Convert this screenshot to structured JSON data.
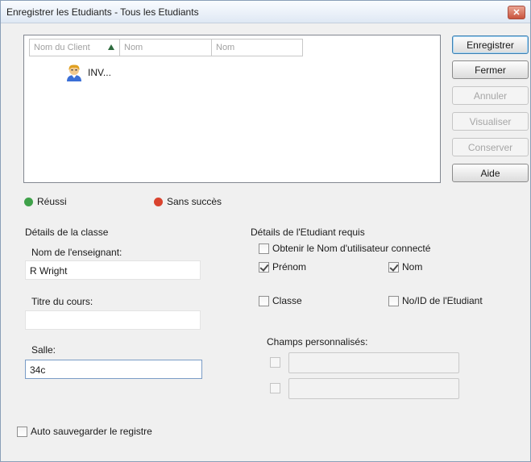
{
  "window": {
    "title": "Enregistrer les Etudiants - Tous les Etudiants",
    "close_label": "✕"
  },
  "list": {
    "columns": [
      "Nom du Client",
      "Nom",
      "Nom"
    ],
    "rows": [
      {
        "name": "INV..."
      }
    ]
  },
  "buttons": {
    "register": "Enregistrer",
    "close": "Fermer",
    "cancel": "Annuler",
    "view": "Visualiser",
    "save": "Conserver",
    "help": "Aide"
  },
  "legend": {
    "success": "Réussi",
    "fail": "Sans succès"
  },
  "class_details": {
    "heading": "Détails de la classe",
    "teacher_label": "Nom de l'enseignant:",
    "teacher_value": "R Wright",
    "course_label": "Titre du cours:",
    "course_value": "",
    "room_label": "Salle:",
    "room_value": "34c"
  },
  "student_details": {
    "heading": "Détails de l'Etudiant requis",
    "get_login": "Obtenir le Nom d'utilisateur connecté",
    "first_name": "Prénom",
    "last_name": "Nom",
    "class": "Classe",
    "student_id": "No/ID de l'Etudiant",
    "custom_label": "Champs personnalisés:"
  },
  "autosave_label": "Auto sauvegarder le registre"
}
